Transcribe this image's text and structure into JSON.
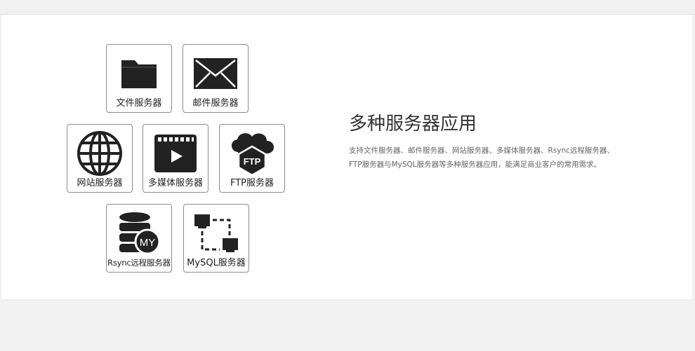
{
  "servers": {
    "file": {
      "label": "文件服务器",
      "icon": "folder-icon"
    },
    "mail": {
      "label": "邮件服务器",
      "icon": "envelope-icon"
    },
    "web": {
      "label": "网站服务器",
      "icon": "globe-icon"
    },
    "media": {
      "label": "多媒体服务器",
      "icon": "video-play-icon"
    },
    "ftp": {
      "label": "FTP服务器",
      "icon": "ftp-cloud-icon",
      "icon_text": "FTP"
    },
    "rsync": {
      "label": "Rsync远程服务器",
      "icon": "database-icon",
      "icon_text": "MY"
    },
    "mysql": {
      "label": "MySQL服务器",
      "icon": "network-icon"
    }
  },
  "feature": {
    "title": "多种服务器应用",
    "description": "支持文件服务器、邮件服务器、网站服务器、多媒体服务器、Rsync远程服务器、FTP服务器与MySQL服务器等多种服务器应用，能满足商业客户的常用需求。"
  },
  "colors": {
    "icon": "#222222",
    "border": "#8c8c8c",
    "title": "#333333",
    "text": "#666666"
  }
}
